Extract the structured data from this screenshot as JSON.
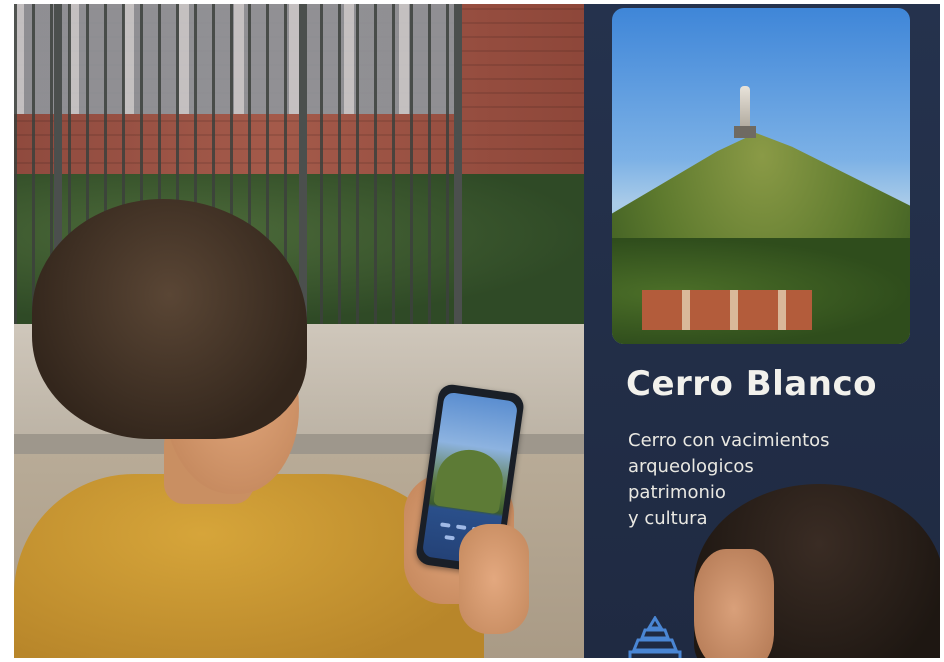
{
  "sign": {
    "title": "Cerro Blanco",
    "description_lines": [
      "Cerro con vacimientos",
      "arqueologicos",
      "patrimonio",
      "y cultura"
    ]
  },
  "icons": {
    "sign_logo": "monument-icon"
  },
  "colors": {
    "sign_background": "#25324d",
    "sign_text": "#f2f1ec",
    "hoodie": "#d6a53a",
    "brick_wall": "#a45a4a"
  }
}
